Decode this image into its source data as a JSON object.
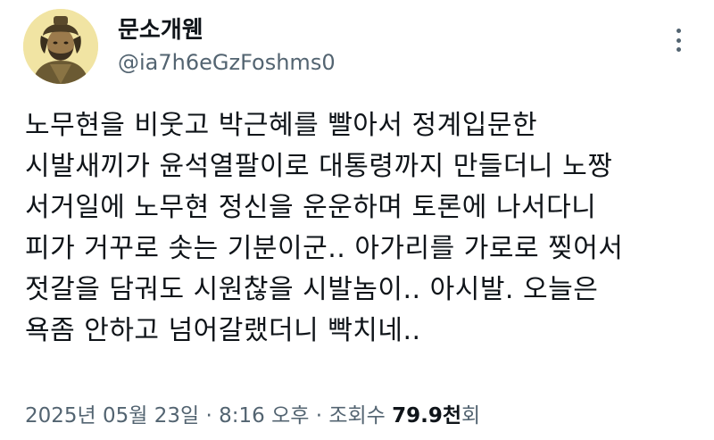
{
  "user": {
    "display_name": "문소개웬",
    "handle": "@ia7h6eGzFoshms0",
    "avatar_icon": "portrait-avatar-icon"
  },
  "menu_icon": "more-vertical-icon",
  "tweet": {
    "lines": [
      "노무현을 비웃고 박근혜를 빨아서 정계입문한",
      "시발새끼가 윤석열팔이로 대통령까지 만들더니 노짱",
      "서거일에 노무현 정신을 운운하며 토론에 나서다니",
      "피가 거꾸로 솟는 기분이군.. 아가리를 가로로 찢어서",
      "젓갈을 담궈도 시원찮을 시발놈이.. 아시발. 오늘은",
      "욕좀 안하고 넘어갈랬더니 빡치네.."
    ]
  },
  "meta": {
    "date": "2025년 05월 23일",
    "separator1": " · ",
    "time": "8:16 오후",
    "separator2": " · ",
    "views_label": "조회수 ",
    "views_count": "79.9천",
    "views_suffix": "회"
  },
  "colors": {
    "text": "#0f1419",
    "secondary": "#536471",
    "background": "#ffffff"
  }
}
